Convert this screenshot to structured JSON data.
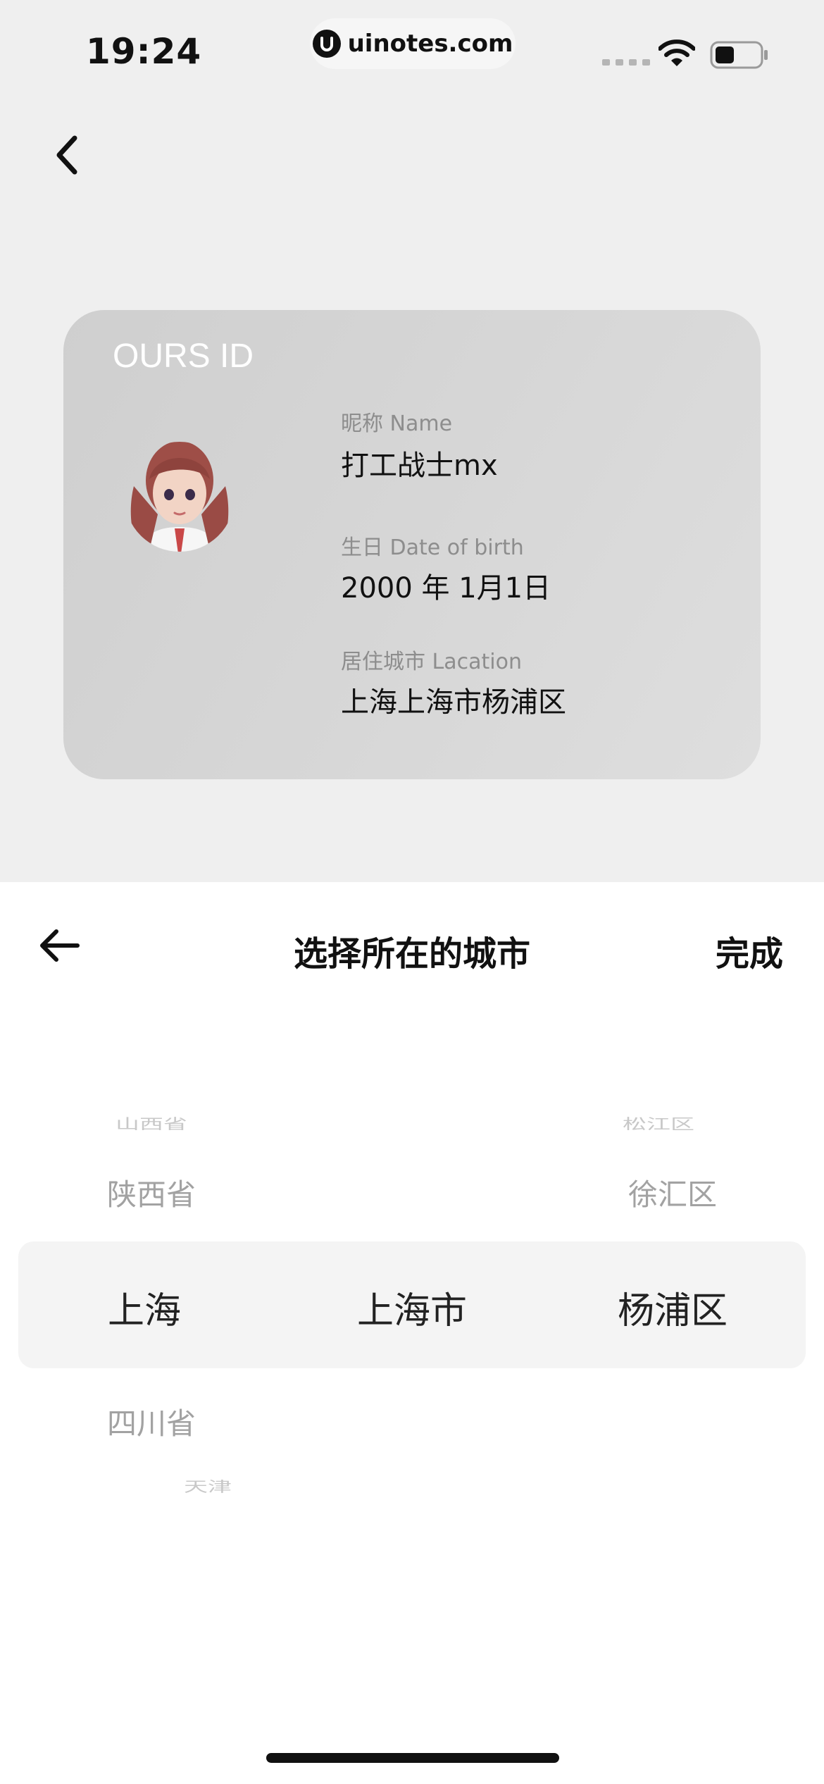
{
  "status_bar": {
    "time": "19:24",
    "url": "uinotes.com",
    "icons": [
      "cellular-signal-icon",
      "wifi-icon",
      "battery-icon"
    ]
  },
  "nav": {
    "back_icon": "chevron-left-icon"
  },
  "card": {
    "title": "OURS ID",
    "avatar": "avatar",
    "fields": [
      {
        "label": "昵称 Name",
        "value": "打工战士mx"
      },
      {
        "label": "生日 Date of birth",
        "value": "2000 年 1月1日"
      },
      {
        "label": "居住城市 Lacation",
        "value": "上海上海市杨浦区"
      }
    ]
  },
  "sheet": {
    "back_icon": "arrow-left-icon",
    "title": "选择所在的城市",
    "done_label": "完成",
    "province_column": {
      "far_above": "山西省",
      "above": "陕西省",
      "selected": "上海",
      "below": "四川省",
      "far_below": "天津"
    },
    "city_column": {
      "selected": "上海市"
    },
    "district_column": {
      "far_above": "松江区",
      "above": "徐汇区",
      "selected": "杨浦区"
    }
  },
  "colors": {
    "background": "#efefef",
    "sheet": "#ffffff",
    "selection_band": "#f4f4f4",
    "muted_text": "#a2a2a2"
  }
}
